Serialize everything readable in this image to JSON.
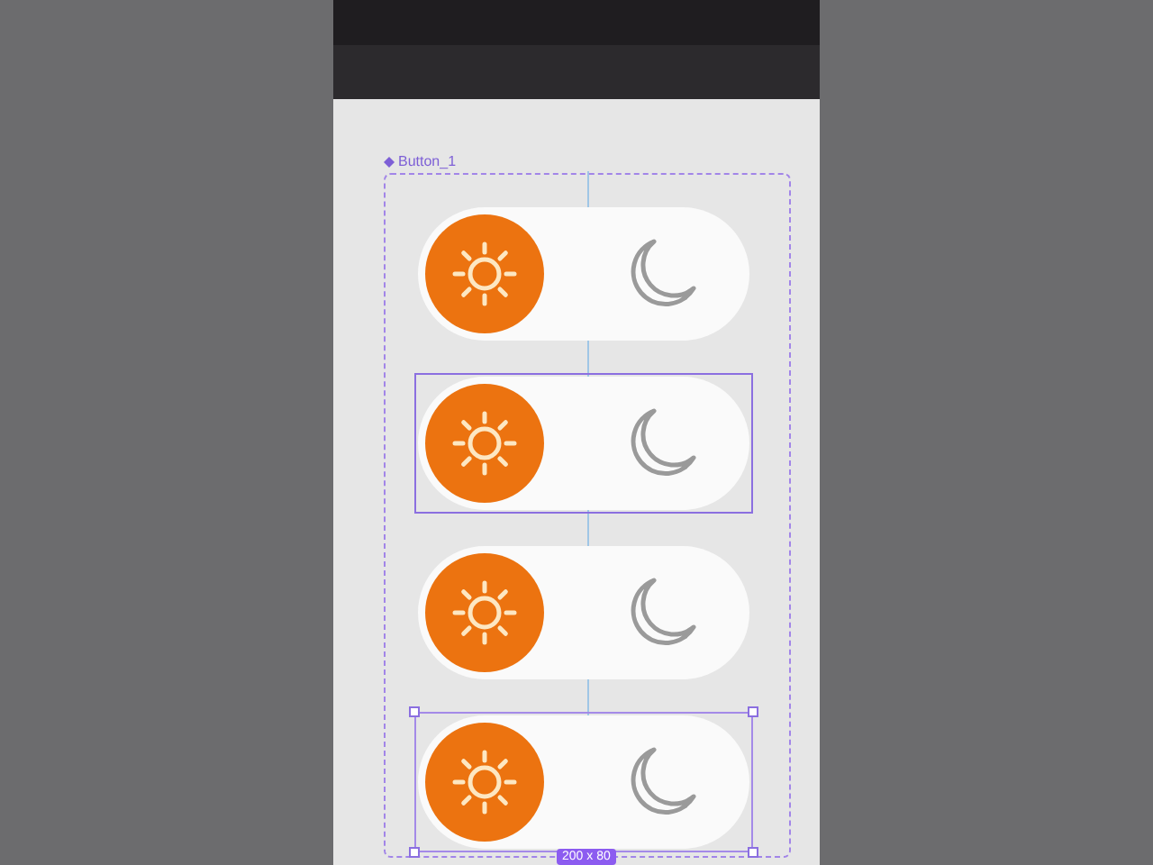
{
  "frame": {
    "label": "Button_1"
  },
  "toggles": [
    {
      "on": true,
      "hovered": false,
      "selected": false
    },
    {
      "on": true,
      "hovered": true,
      "selected": false
    },
    {
      "on": true,
      "hovered": false,
      "selected": false
    },
    {
      "on": true,
      "hovered": false,
      "selected": true
    }
  ],
  "size_label": "200 x 80"
}
